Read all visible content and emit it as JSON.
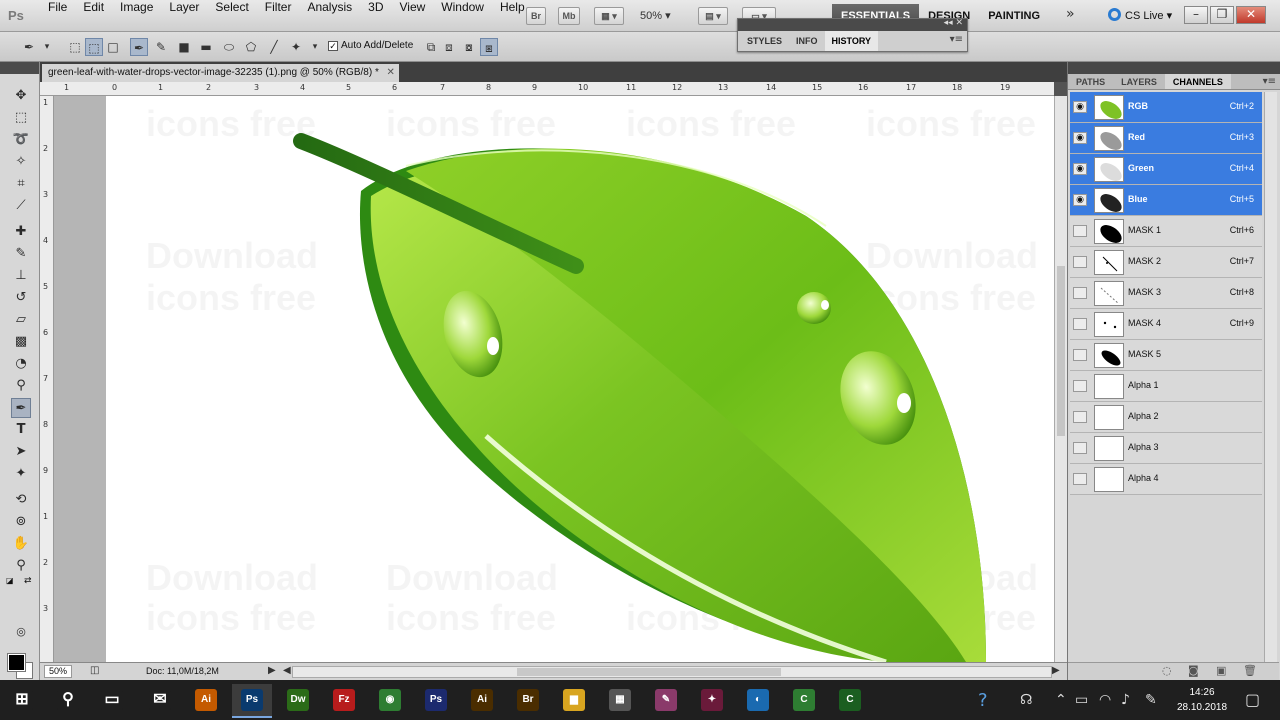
{
  "app": {
    "logo": "Ps",
    "zoom_select": "50%"
  },
  "menu": [
    "File",
    "Edit",
    "Image",
    "Layer",
    "Select",
    "Filter",
    "Analysis",
    "3D",
    "View",
    "Window",
    "Help"
  ],
  "menu_buttons": {
    "bridge": "Br",
    "mini_bridge": "Mb"
  },
  "workspaces": [
    {
      "label": "ESSENTIALS",
      "active": true
    },
    {
      "label": "DESIGN",
      "active": false
    },
    {
      "label": "PAINTING",
      "active": false
    }
  ],
  "cs_live": "CS Live",
  "options": {
    "auto_add_delete": "Auto Add/Delete",
    "auto_add_checked": true
  },
  "history_panel": {
    "tabs": [
      "STYLES",
      "INFO",
      "HISTORY"
    ],
    "active": "HISTORY"
  },
  "document": {
    "tab_title": "green-leaf-with-water-drops-vector-image-32235 (1).png @ 50% (RGB/8) *",
    "zoom": "50%",
    "doc_info": "Doc: 11,0M/18,2M"
  },
  "ruler_h_labels": [
    "1",
    "0",
    "1",
    "2",
    "3",
    "4",
    "5",
    "6",
    "7",
    "8",
    "9",
    "10",
    "11",
    "12",
    "13",
    "14",
    "15",
    "16",
    "17",
    "18",
    "19"
  ],
  "ruler_v_labels": [
    "1",
    "2",
    "3",
    "4",
    "5",
    "6",
    "7",
    "8",
    "9",
    "1",
    "2",
    "3"
  ],
  "watermark": [
    {
      "text": "icons free"
    },
    {
      "text": "icons free"
    },
    {
      "text": "icons free"
    },
    {
      "text": "icons free"
    },
    {
      "text": "Download"
    },
    {
      "text": "icons free"
    },
    {
      "text": "Download"
    },
    {
      "text": "Download"
    },
    {
      "text": "icons free"
    },
    {
      "text": "Download"
    },
    {
      "text": "Download"
    },
    {
      "text": "icons free"
    },
    {
      "text": "icons free"
    },
    {
      "text": "icons free"
    },
    {
      "text": "icons free"
    },
    {
      "text": "Download"
    },
    {
      "text": "Download"
    }
  ],
  "channels_panel": {
    "tabs": [
      "PATHS",
      "LAYERS",
      "CHANNELS"
    ],
    "active": "CHANNELS",
    "channels": [
      {
        "name": "RGB",
        "shortcut": "Ctrl+2",
        "selected": true,
        "visible": true
      },
      {
        "name": "Red",
        "shortcut": "Ctrl+3",
        "selected": true,
        "visible": true
      },
      {
        "name": "Green",
        "shortcut": "Ctrl+4",
        "selected": true,
        "visible": true
      },
      {
        "name": "Blue",
        "shortcut": "Ctrl+5",
        "selected": true,
        "visible": true
      },
      {
        "name": "MASK 1",
        "shortcut": "Ctrl+6",
        "selected": false,
        "visible": false
      },
      {
        "name": "MASK 2",
        "shortcut": "Ctrl+7",
        "selected": false,
        "visible": false
      },
      {
        "name": "MASK 3",
        "shortcut": "Ctrl+8",
        "selected": false,
        "visible": false
      },
      {
        "name": "MASK 4",
        "shortcut": "Ctrl+9",
        "selected": false,
        "visible": false
      },
      {
        "name": "MASK 5",
        "shortcut": "",
        "selected": false,
        "visible": false
      },
      {
        "name": "Alpha 1",
        "shortcut": "",
        "selected": false,
        "visible": false
      },
      {
        "name": "Alpha 2",
        "shortcut": "",
        "selected": false,
        "visible": false
      },
      {
        "name": "Alpha 3",
        "shortcut": "",
        "selected": false,
        "visible": false
      },
      {
        "name": "Alpha 4",
        "shortcut": "",
        "selected": false,
        "visible": false
      }
    ]
  },
  "taskbar": {
    "apps": [
      {
        "name": "windows-start",
        "glyph": "⊞",
        "color": "#1f1f1f"
      },
      {
        "name": "search",
        "glyph": "⚲",
        "color": "#1f1f1f"
      },
      {
        "name": "task-view",
        "glyph": "▭",
        "color": "#1f1f1f"
      },
      {
        "name": "mail",
        "glyph": "✉",
        "color": "#1f1f1f"
      },
      {
        "name": "illustrator-old",
        "glyph": "Ai",
        "color": "#c45a00"
      },
      {
        "name": "photoshop",
        "glyph": "Ps",
        "color": "#0a3a6e"
      },
      {
        "name": "dreamweaver",
        "glyph": "Dw",
        "color": "#2b6b18"
      },
      {
        "name": "filezilla",
        "glyph": "Fz",
        "color": "#b71c1c"
      },
      {
        "name": "chrome",
        "glyph": "◉",
        "color": "#2e7d32"
      },
      {
        "name": "photoshop-2",
        "glyph": "Ps",
        "color": "#1c2a6e"
      },
      {
        "name": "illustrator",
        "glyph": "Ai",
        "color": "#4a2d00"
      },
      {
        "name": "bridge",
        "glyph": "Br",
        "color": "#4a2d00"
      },
      {
        "name": "file-explorer",
        "glyph": "▆",
        "color": "#d8a520"
      },
      {
        "name": "calculator",
        "glyph": "▦",
        "color": "#555555"
      },
      {
        "name": "paint",
        "glyph": "✎",
        "color": "#8a3a6a"
      },
      {
        "name": "app-pink",
        "glyph": "✦",
        "color": "#6a1a3a"
      },
      {
        "name": "app-globe",
        "glyph": "◐",
        "color": "#1a6ab0"
      },
      {
        "name": "app-green-1",
        "glyph": "C",
        "color": "#2e7d32"
      },
      {
        "name": "app-green-2",
        "glyph": "C",
        "color": "#1b5e20"
      }
    ],
    "active": "photoshop",
    "clock": {
      "time": "14:26",
      "date": "28.10.2018"
    }
  }
}
